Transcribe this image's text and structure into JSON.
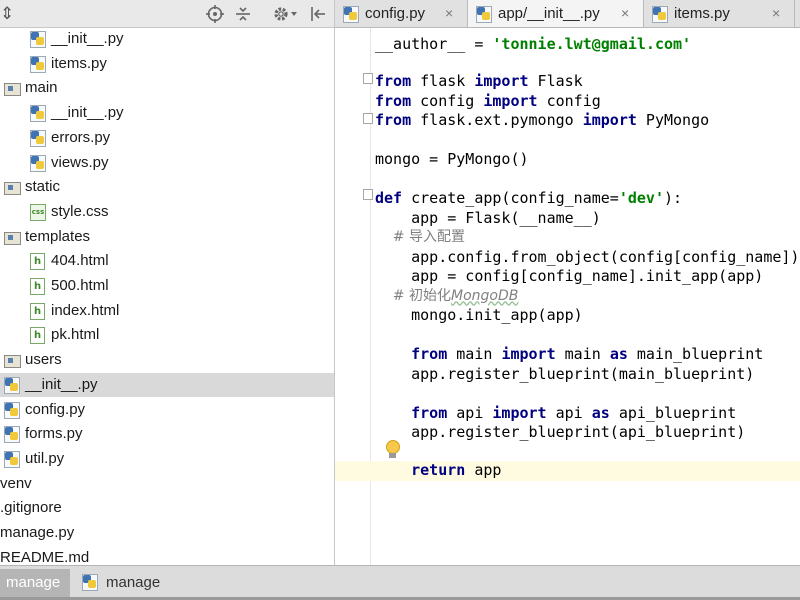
{
  "project": {
    "toolbar_icons": [
      "expand-icon",
      "locate-icon",
      "collapse-icon",
      "settings-icon",
      "hide-icon"
    ],
    "toolbar_glyph_first": "⇕",
    "tree": [
      {
        "label": "__init__.py",
        "icon": "python-file-icon"
      },
      {
        "label": "items.py",
        "icon": "python-file-icon"
      },
      {
        "label": "main",
        "icon": "folder-icon"
      },
      {
        "label": "__init__.py",
        "icon": "python-file-icon"
      },
      {
        "label": "errors.py",
        "icon": "python-file-icon"
      },
      {
        "label": "views.py",
        "icon": "python-file-icon"
      },
      {
        "label": "static",
        "icon": "folder-icon"
      },
      {
        "label": "style.css",
        "icon": "css-file-icon"
      },
      {
        "label": "templates",
        "icon": "folder-icon"
      },
      {
        "label": "404.html",
        "icon": "html-file-icon"
      },
      {
        "label": "500.html",
        "icon": "html-file-icon"
      },
      {
        "label": "index.html",
        "icon": "html-file-icon"
      },
      {
        "label": "pk.html",
        "icon": "html-file-icon"
      },
      {
        "label": "users",
        "icon": "folder-icon"
      },
      {
        "label": "__init__.py",
        "icon": "python-file-icon",
        "selected": true
      },
      {
        "label": "config.py",
        "icon": "python-file-icon"
      },
      {
        "label": "forms.py",
        "icon": "python-file-icon"
      },
      {
        "label": "util.py",
        "icon": "python-file-icon"
      },
      {
        "label": "venv",
        "icon": ""
      },
      {
        "label": ".gitignore",
        "icon": ""
      },
      {
        "label": "manage.py",
        "icon": ""
      },
      {
        "label": "README.md",
        "icon": ""
      }
    ]
  },
  "editor": {
    "tabs": [
      {
        "label": "config.py",
        "close": "×",
        "active": false
      },
      {
        "label": "app/__init__.py",
        "close": "×",
        "active": true
      },
      {
        "label": "items.py",
        "close": "×",
        "active": false
      }
    ],
    "code": {
      "l1_name": "__author__",
      "l1_eq": " = ",
      "l1_str": "'tonnie.lwt@gmail.com'",
      "l3_kw1": "from",
      "l3_mod": " flask ",
      "l3_kw2": "import",
      "l3_name": " Flask",
      "l4_kw1": "from",
      "l4_mod": " config ",
      "l4_kw2": "import",
      "l4_name": " config",
      "l5_kw1": "from",
      "l5_mod": " flask.ext.pymongo ",
      "l5_kw2": "import",
      "l5_name": " PyMongo",
      "l7": "mongo = PyMongo()",
      "l9_kw": "def",
      "l9_sig": " create_app(config_name=",
      "l9_str": "'dev'",
      "l9_end": "):",
      "l10": "    app = Flask(__name__)",
      "l11": "    # 导入配置",
      "l12": "    app.config.from_object(config[config_name])",
      "l13": "    app = config[config_name].init_app(app)",
      "l14a": "    # 初始化",
      "l14b": "MongoDB",
      "l15": "    mongo.init_app(app)",
      "l17_kw1": "from",
      "l17_a": " main ",
      "l17_kw2": "import",
      "l17_b": " main ",
      "l17_kw3": "as",
      "l17_c": " main_blueprint",
      "l18": "    app.register_blueprint(main_blueprint)",
      "l20_kw1": "from",
      "l20_a": " api ",
      "l20_kw2": "import",
      "l20_b": " api ",
      "l20_kw3": "as",
      "l20_c": " api_blueprint",
      "l21": "    app.register_blueprint(api_blueprint)",
      "l23_kw": "return",
      "l23_v": " app"
    }
  },
  "bottom": {
    "tabs": [
      {
        "label": "manage",
        "active": true
      },
      {
        "label": "manage",
        "active": false
      }
    ]
  },
  "colors": {
    "keyword": "#000080",
    "string": "#008000",
    "comment": "#808080",
    "current_line": "#fffbe0",
    "selection": "#d9d9d9"
  }
}
